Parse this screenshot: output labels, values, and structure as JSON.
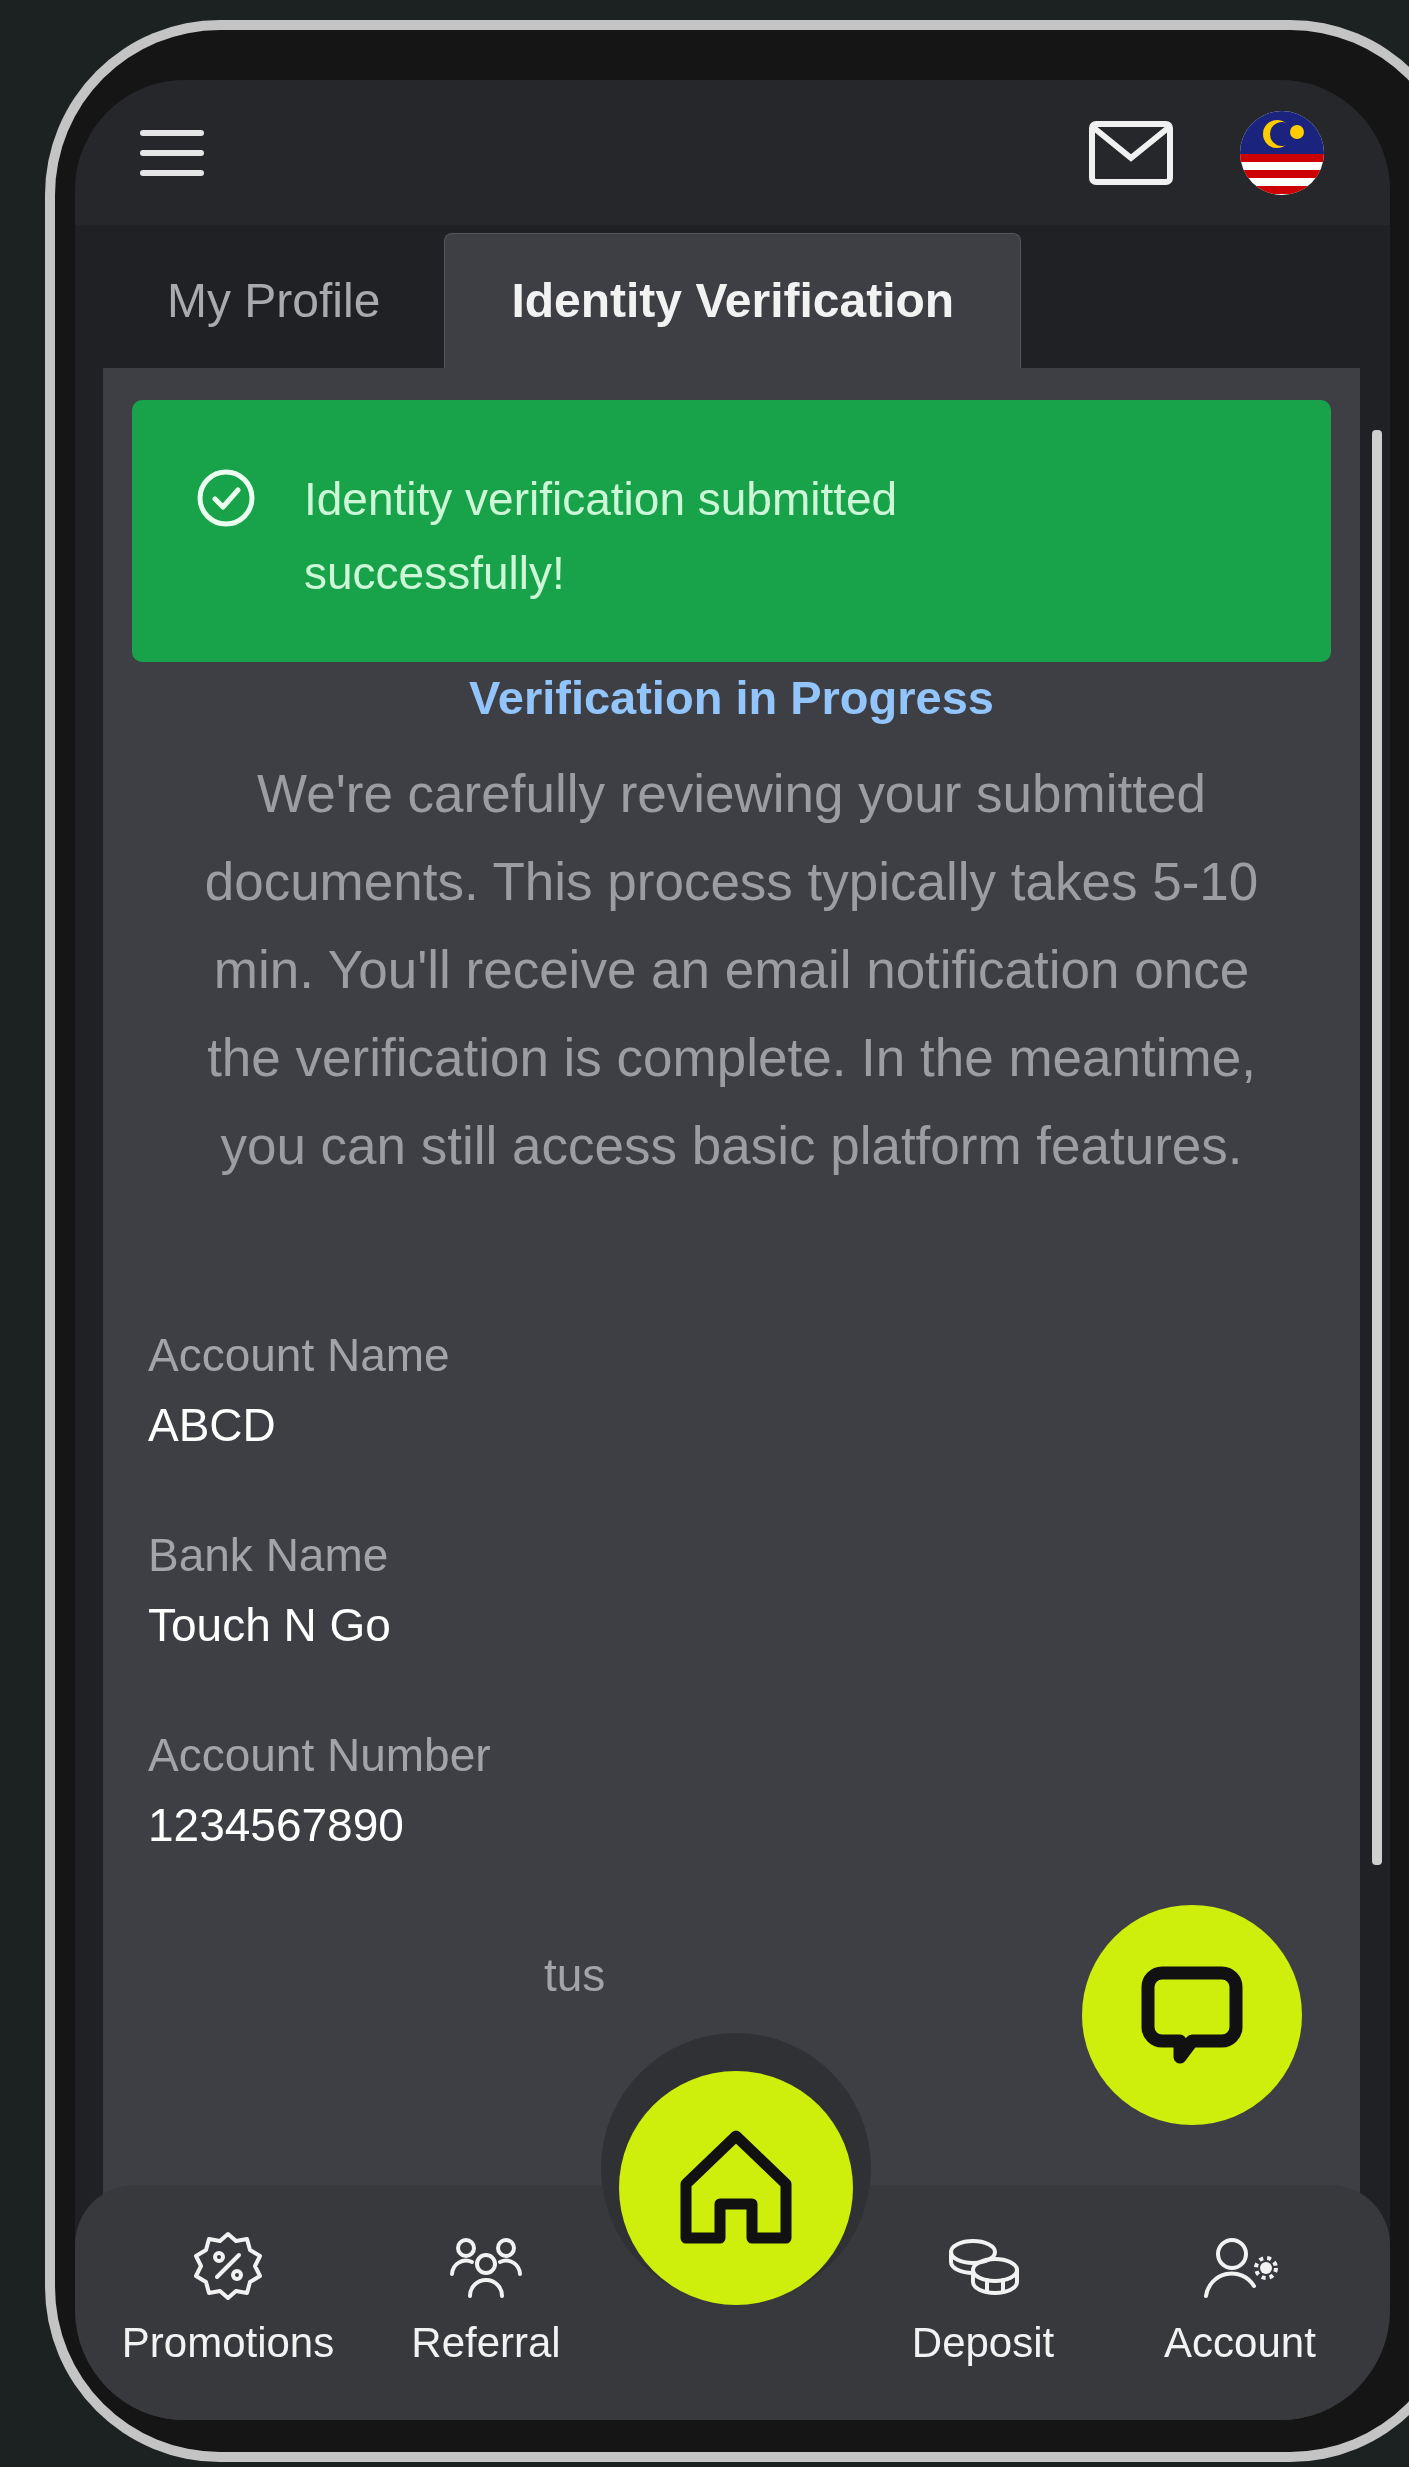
{
  "tabs": [
    {
      "label": "My Profile",
      "selected": false
    },
    {
      "label": "Identity Verification",
      "selected": true
    }
  ],
  "alert": {
    "message": "Identity verification submitted successfully!"
  },
  "status": {
    "title": "Verification in Progress",
    "description": "We're carefully reviewing your submitted documents. This process typically takes 5-10 min. You'll receive an email notification once the verification is complete. In the meantime, you can still access basic platform features."
  },
  "fields": [
    {
      "label": "Account Name",
      "value": "ABCD"
    },
    {
      "label": "Bank Name",
      "value": "Touch N Go"
    },
    {
      "label": "Account Number",
      "value": "1234567890"
    }
  ],
  "obscured_label": "tus",
  "nav": [
    {
      "label": "Promotions",
      "kind": "promo"
    },
    {
      "label": "Referral",
      "kind": "referral"
    },
    {
      "label": "Deposit",
      "kind": "deposit"
    },
    {
      "label": "Account",
      "kind": "account"
    }
  ]
}
